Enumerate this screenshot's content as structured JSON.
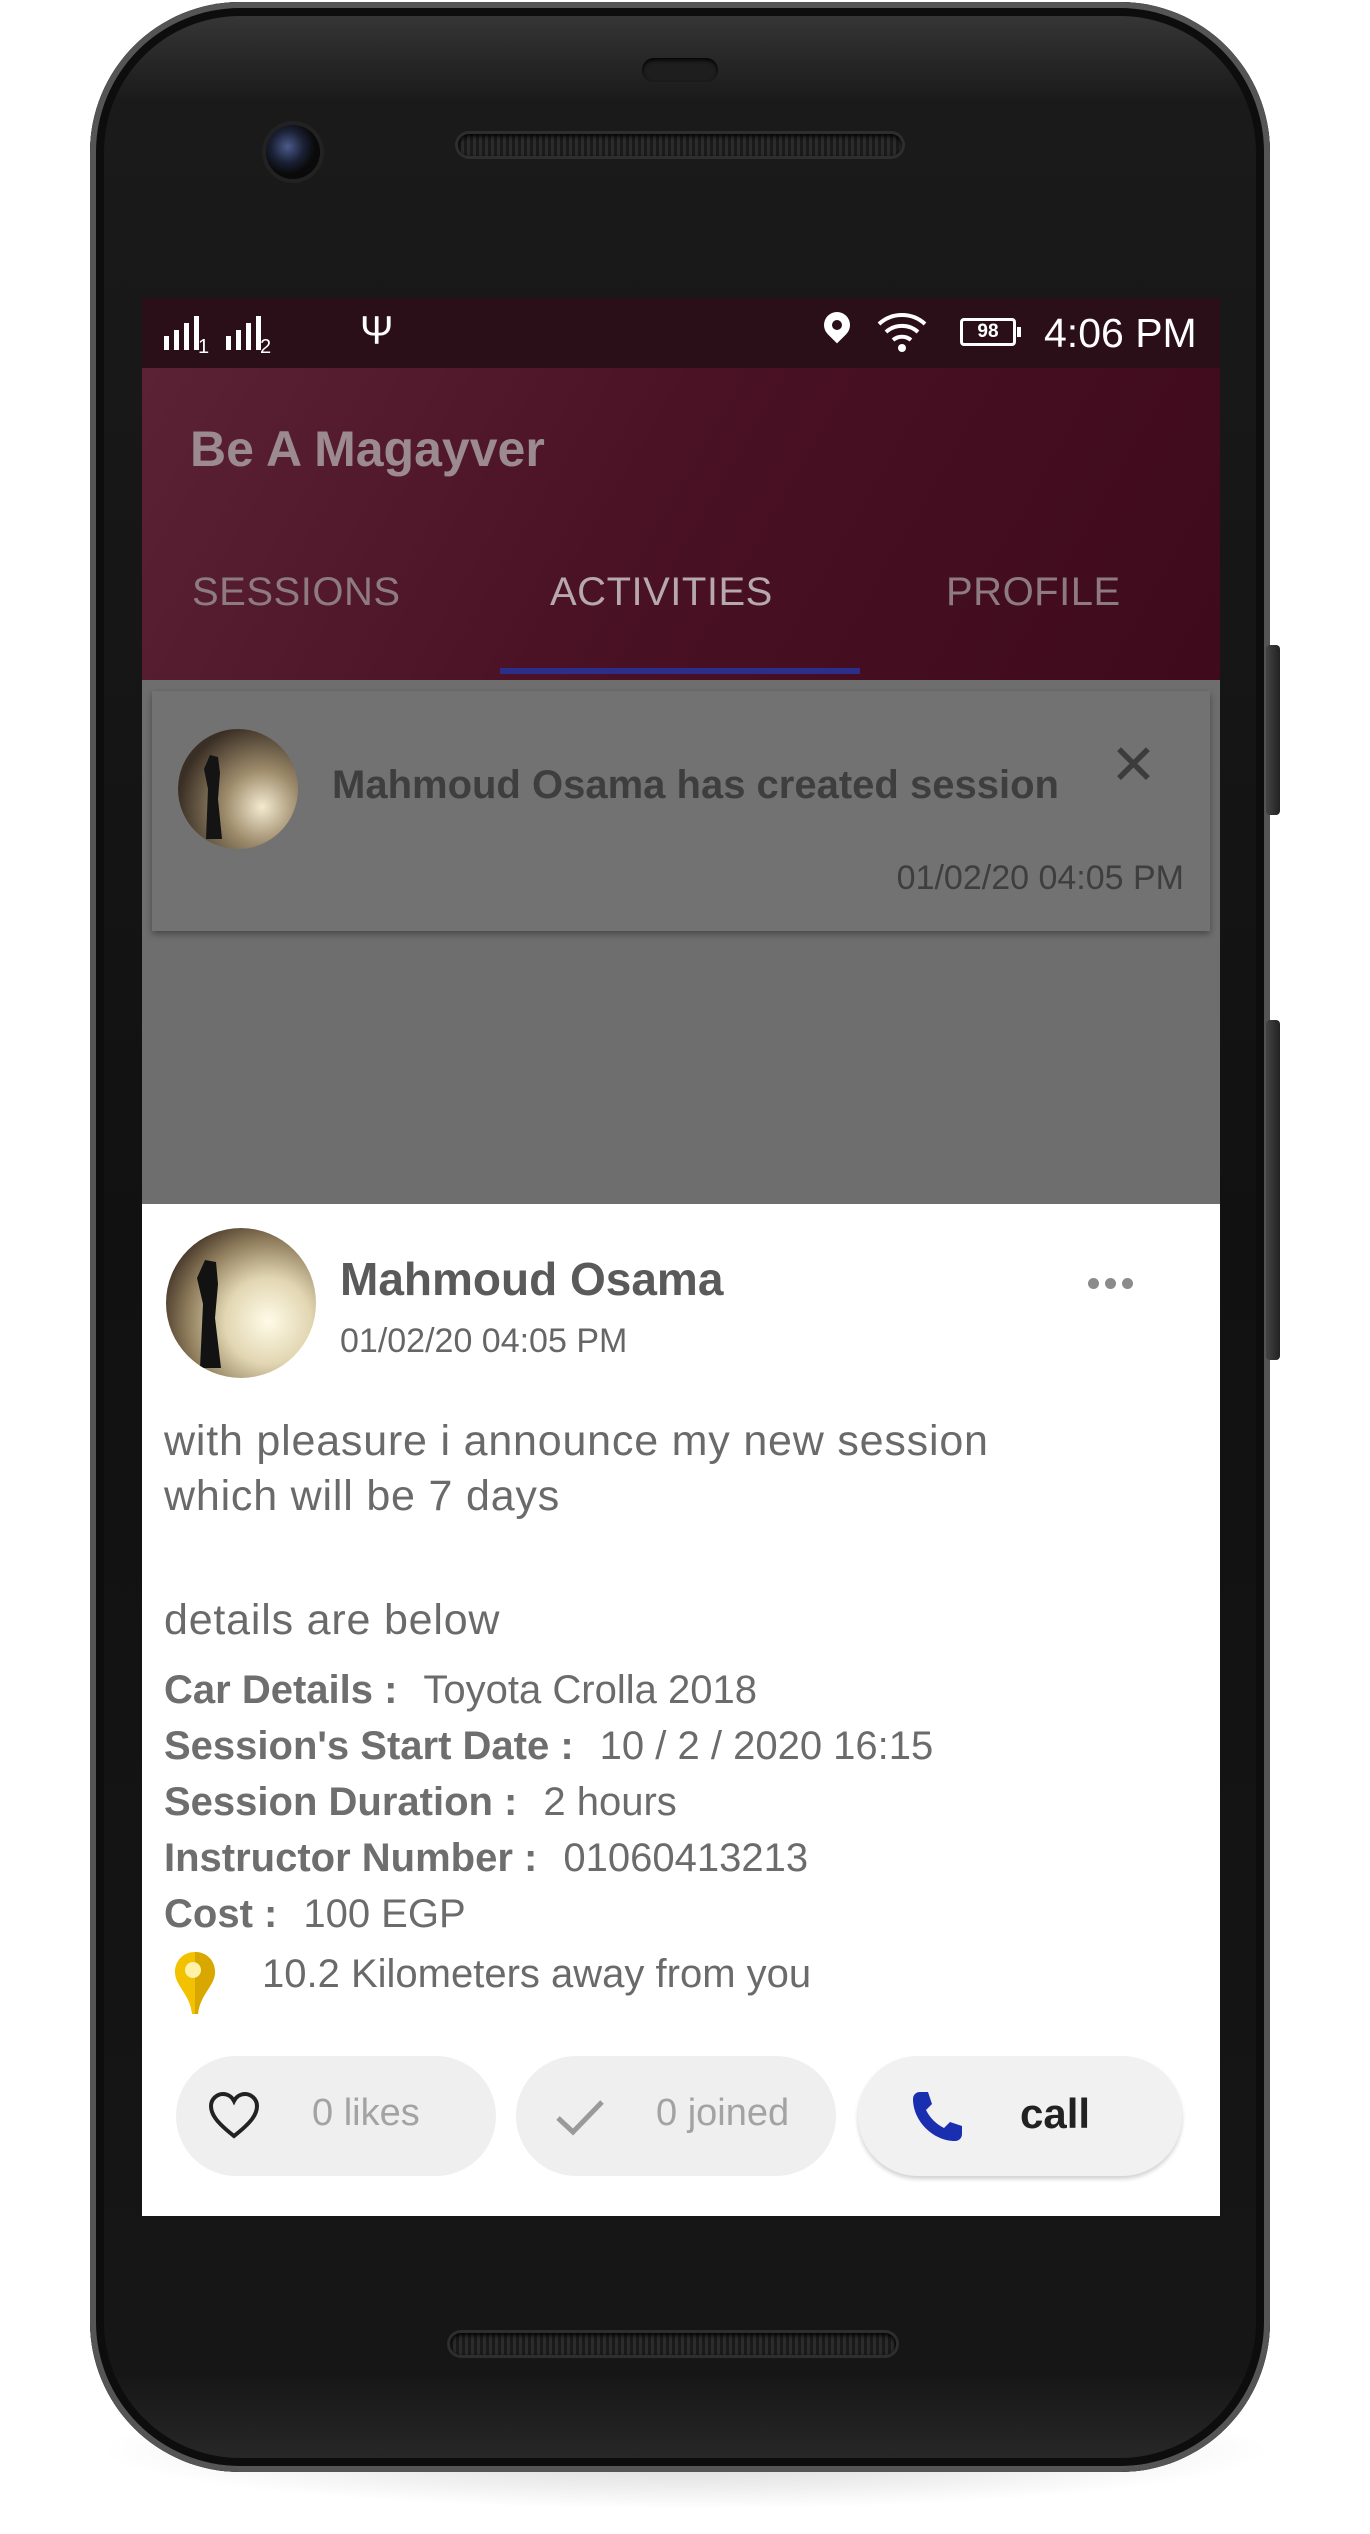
{
  "status_bar": {
    "sim1": "1",
    "sim2": "2",
    "battery": "98",
    "time": "4:06 PM"
  },
  "app": {
    "title": "Be A Magayver",
    "tabs": [
      {
        "label": "SESSIONS",
        "active": false
      },
      {
        "label": "ACTIVITIES",
        "active": true
      },
      {
        "label": "PROFILE",
        "active": false
      }
    ]
  },
  "activity": {
    "text": "Mahmoud Osama has created session",
    "time": "01/02/20 04:05 PM"
  },
  "post": {
    "author": "Mahmoud Osama",
    "time": "01/02/20 04:05 PM",
    "body_line1": "with pleasure i announce my new session",
    "body_line2": "which will be 7 days",
    "details_intro": "details are below",
    "details": [
      {
        "label": "Car Details :",
        "value": "Toyota Crolla 2018"
      },
      {
        "label": "Session's Start Date :",
        "value": "10 / 2 / 2020 16:15"
      },
      {
        "label": "Session Duration :",
        "value": "2 hours"
      },
      {
        "label": "Instructor Number :",
        "value": "01060413213"
      },
      {
        "label": "Cost :",
        "value": "100 EGP"
      }
    ],
    "distance": "10.2 Kilometers away from you",
    "likes_label": "0 likes",
    "joined_label": "0 joined",
    "call_label": "call"
  },
  "colors": {
    "app_bar": "#4a1224",
    "status_bar": "#2a0f18",
    "tab_indicator": "#2b2f8a",
    "call_icon": "#1a2fb0",
    "pin_icon": "#f2c200"
  }
}
